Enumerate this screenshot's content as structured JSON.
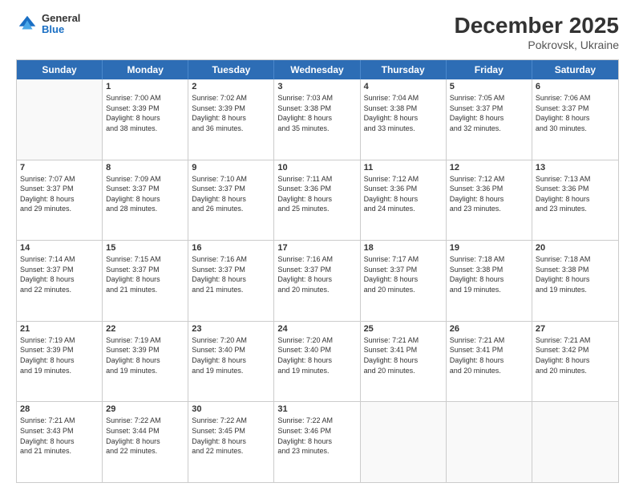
{
  "logo": {
    "general": "General",
    "blue": "Blue"
  },
  "header": {
    "month": "December 2025",
    "location": "Pokrovsk, Ukraine"
  },
  "weekdays": [
    "Sunday",
    "Monday",
    "Tuesday",
    "Wednesday",
    "Thursday",
    "Friday",
    "Saturday"
  ],
  "rows": [
    [
      {
        "day": "",
        "info": "",
        "empty": true
      },
      {
        "day": "1",
        "info": "Sunrise: 7:00 AM\nSunset: 3:39 PM\nDaylight: 8 hours\nand 38 minutes."
      },
      {
        "day": "2",
        "info": "Sunrise: 7:02 AM\nSunset: 3:39 PM\nDaylight: 8 hours\nand 36 minutes."
      },
      {
        "day": "3",
        "info": "Sunrise: 7:03 AM\nSunset: 3:38 PM\nDaylight: 8 hours\nand 35 minutes."
      },
      {
        "day": "4",
        "info": "Sunrise: 7:04 AM\nSunset: 3:38 PM\nDaylight: 8 hours\nand 33 minutes."
      },
      {
        "day": "5",
        "info": "Sunrise: 7:05 AM\nSunset: 3:37 PM\nDaylight: 8 hours\nand 32 minutes."
      },
      {
        "day": "6",
        "info": "Sunrise: 7:06 AM\nSunset: 3:37 PM\nDaylight: 8 hours\nand 30 minutes."
      }
    ],
    [
      {
        "day": "7",
        "info": "Sunrise: 7:07 AM\nSunset: 3:37 PM\nDaylight: 8 hours\nand 29 minutes."
      },
      {
        "day": "8",
        "info": "Sunrise: 7:09 AM\nSunset: 3:37 PM\nDaylight: 8 hours\nand 28 minutes."
      },
      {
        "day": "9",
        "info": "Sunrise: 7:10 AM\nSunset: 3:37 PM\nDaylight: 8 hours\nand 26 minutes."
      },
      {
        "day": "10",
        "info": "Sunrise: 7:11 AM\nSunset: 3:36 PM\nDaylight: 8 hours\nand 25 minutes."
      },
      {
        "day": "11",
        "info": "Sunrise: 7:12 AM\nSunset: 3:36 PM\nDaylight: 8 hours\nand 24 minutes."
      },
      {
        "day": "12",
        "info": "Sunrise: 7:12 AM\nSunset: 3:36 PM\nDaylight: 8 hours\nand 23 minutes."
      },
      {
        "day": "13",
        "info": "Sunrise: 7:13 AM\nSunset: 3:36 PM\nDaylight: 8 hours\nand 23 minutes."
      }
    ],
    [
      {
        "day": "14",
        "info": "Sunrise: 7:14 AM\nSunset: 3:37 PM\nDaylight: 8 hours\nand 22 minutes."
      },
      {
        "day": "15",
        "info": "Sunrise: 7:15 AM\nSunset: 3:37 PM\nDaylight: 8 hours\nand 21 minutes."
      },
      {
        "day": "16",
        "info": "Sunrise: 7:16 AM\nSunset: 3:37 PM\nDaylight: 8 hours\nand 21 minutes."
      },
      {
        "day": "17",
        "info": "Sunrise: 7:16 AM\nSunset: 3:37 PM\nDaylight: 8 hours\nand 20 minutes."
      },
      {
        "day": "18",
        "info": "Sunrise: 7:17 AM\nSunset: 3:37 PM\nDaylight: 8 hours\nand 20 minutes."
      },
      {
        "day": "19",
        "info": "Sunrise: 7:18 AM\nSunset: 3:38 PM\nDaylight: 8 hours\nand 19 minutes."
      },
      {
        "day": "20",
        "info": "Sunrise: 7:18 AM\nSunset: 3:38 PM\nDaylight: 8 hours\nand 19 minutes."
      }
    ],
    [
      {
        "day": "21",
        "info": "Sunrise: 7:19 AM\nSunset: 3:39 PM\nDaylight: 8 hours\nand 19 minutes."
      },
      {
        "day": "22",
        "info": "Sunrise: 7:19 AM\nSunset: 3:39 PM\nDaylight: 8 hours\nand 19 minutes."
      },
      {
        "day": "23",
        "info": "Sunrise: 7:20 AM\nSunset: 3:40 PM\nDaylight: 8 hours\nand 19 minutes."
      },
      {
        "day": "24",
        "info": "Sunrise: 7:20 AM\nSunset: 3:40 PM\nDaylight: 8 hours\nand 19 minutes."
      },
      {
        "day": "25",
        "info": "Sunrise: 7:21 AM\nSunset: 3:41 PM\nDaylight: 8 hours\nand 20 minutes."
      },
      {
        "day": "26",
        "info": "Sunrise: 7:21 AM\nSunset: 3:41 PM\nDaylight: 8 hours\nand 20 minutes."
      },
      {
        "day": "27",
        "info": "Sunrise: 7:21 AM\nSunset: 3:42 PM\nDaylight: 8 hours\nand 20 minutes."
      }
    ],
    [
      {
        "day": "28",
        "info": "Sunrise: 7:21 AM\nSunset: 3:43 PM\nDaylight: 8 hours\nand 21 minutes."
      },
      {
        "day": "29",
        "info": "Sunrise: 7:22 AM\nSunset: 3:44 PM\nDaylight: 8 hours\nand 22 minutes."
      },
      {
        "day": "30",
        "info": "Sunrise: 7:22 AM\nSunset: 3:45 PM\nDaylight: 8 hours\nand 22 minutes."
      },
      {
        "day": "31",
        "info": "Sunrise: 7:22 AM\nSunset: 3:46 PM\nDaylight: 8 hours\nand 23 minutes."
      },
      {
        "day": "",
        "info": "",
        "empty": true
      },
      {
        "day": "",
        "info": "",
        "empty": true
      },
      {
        "day": "",
        "info": "",
        "empty": true
      }
    ]
  ]
}
